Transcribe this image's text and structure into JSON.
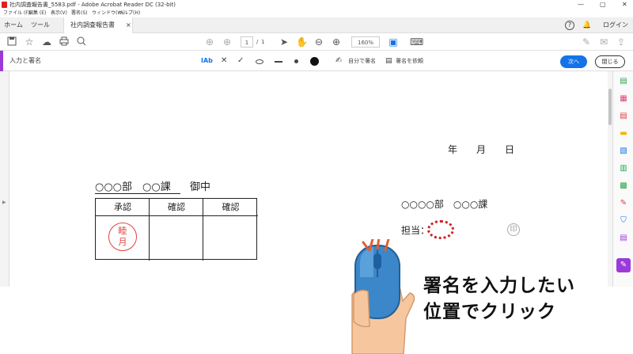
{
  "window": {
    "title": "社内調査報告書_5583.pdf - Adobe Acrobat Reader DC (32-bit)",
    "controls": [
      "—",
      "▢",
      "✕"
    ]
  },
  "menu": [
    "ファイル (F)",
    "編集 (E)",
    "表示(V)",
    "署名(S)",
    "ウィンドウ(W)",
    "ヘルプ(H)"
  ],
  "tabs": {
    "home": "ホーム",
    "tools": "ツール",
    "document": "社内調査報告書_558...",
    "close": "×",
    "help": "?",
    "bell": "🔔",
    "login": "ログイン"
  },
  "toolbar": {
    "page_current": "1",
    "page_separator": "/",
    "page_total": "1",
    "zoom": "160%"
  },
  "signbar": {
    "label": "入力と署名",
    "text_tool": "IAb",
    "self_sign": "自分で署名",
    "request_sign": "署名を依頼",
    "next": "次へ",
    "close": "閉じる"
  },
  "document": {
    "date_line": "年　　月　　日",
    "addressee": "○○○部　○○課",
    "honorific": "御中",
    "approval_headers": [
      "承認",
      "確認",
      "確認"
    ],
    "stamp_text_top": "睦",
    "stamp_text_bottom": "月",
    "department": "○○○○部　○○○課",
    "person_label": "担当：",
    "seal_mark": "印"
  },
  "callout": {
    "line1": "署名を入力したい",
    "line2": "位置でクリック"
  },
  "colors": {
    "accent_purple": "#9b3ad8",
    "primary_blue": "#1473e6",
    "stamp_red": "#e04040"
  }
}
